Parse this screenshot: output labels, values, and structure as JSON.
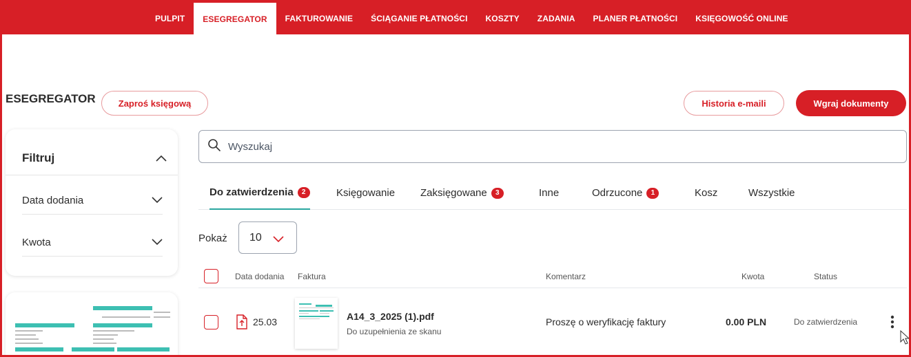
{
  "nav": {
    "items": [
      {
        "label": "PULPIT",
        "active": false
      },
      {
        "label": "ESEGREGATOR",
        "active": true
      },
      {
        "label": "FAKTUROWANIE",
        "active": false
      },
      {
        "label": "ŚCIĄGANIE PŁATNOŚCI",
        "active": false
      },
      {
        "label": "KOSZTY",
        "active": false
      },
      {
        "label": "ZADANIA",
        "active": false
      },
      {
        "label": "PLANER PŁATNOŚCI",
        "active": false
      },
      {
        "label": "KSIĘGOWOŚĆ ONLINE",
        "active": false
      }
    ]
  },
  "colors": {
    "brand": "#d71f26",
    "accent": "#2aa7a0"
  },
  "page": {
    "title": "ESEGREGATOR",
    "invite_button": "Zaproś księgową",
    "history_button": "Historia e-maili",
    "upload_button": "Wgraj dokumenty"
  },
  "filters": {
    "title": "Filtruj",
    "date_label": "Data dodania",
    "amount_label": "Kwota"
  },
  "search": {
    "placeholder": "Wyszukaj",
    "value": ""
  },
  "tabs": [
    {
      "label": "Do zatwierdzenia",
      "count": "2",
      "active": true
    },
    {
      "label": "Księgowanie",
      "count": null,
      "active": false
    },
    {
      "label": "Zaksięgowane",
      "count": "3",
      "active": false
    },
    {
      "label": "Inne",
      "count": null,
      "active": false
    },
    {
      "label": "Odrzucone",
      "count": "1",
      "active": false
    },
    {
      "label": "Kosz",
      "count": null,
      "active": false
    },
    {
      "label": "Wszystkie",
      "count": null,
      "active": false
    }
  ],
  "pagination": {
    "show_label": "Pokaż",
    "page_size": "10"
  },
  "table": {
    "headers": {
      "date": "Data dodania",
      "invoice": "Faktura",
      "comment": "Komentarz",
      "amount": "Kwota",
      "status": "Status"
    },
    "rows": [
      {
        "date": "25.03",
        "filename": "A14_3_2025 (1).pdf",
        "source": "Do uzupełnienia ze skanu",
        "comment": "Proszę o weryfikację faktury",
        "amount": "0.00 PLN",
        "status": "Do zatwierdzenia"
      }
    ]
  }
}
